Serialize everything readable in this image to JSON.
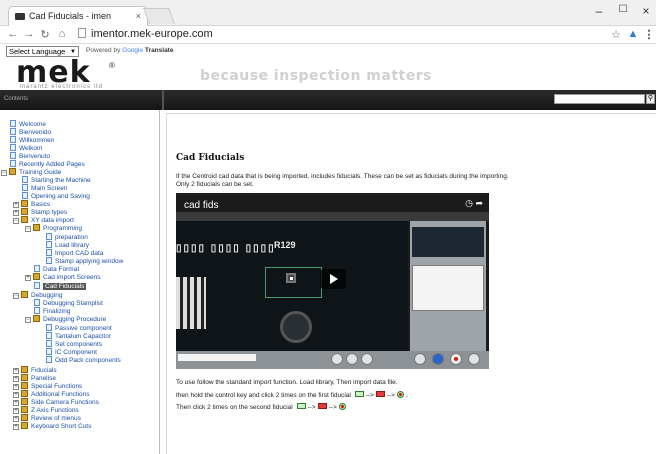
{
  "browser": {
    "tab_title": "Cad Fiducials - imen",
    "tab_close": "×",
    "url": "imentor.mek-europe.com",
    "win_minimize": "–",
    "win_maximize": "☐",
    "win_close": "×",
    "icons": [
      "back-icon",
      "forward-icon",
      "reload-icon",
      "home-icon",
      "page-icon",
      "star-icon",
      "extension-icon",
      "menu-icon"
    ]
  },
  "translate": {
    "select_label": "Select Language",
    "powered_by": "Powered by",
    "google": "Google",
    "translate_word": "Translate"
  },
  "header": {
    "logo": "mek",
    "logo_reg": "®",
    "logo_sub": "marantz electronics ltd",
    "slogan": "because inspection matters",
    "contents_label": "Contents"
  },
  "sidebar": {
    "items": [
      {
        "label": "Welcome",
        "icon": "page"
      },
      {
        "label": "Bienvenido",
        "icon": "page"
      },
      {
        "label": "Willkommen",
        "icon": "page"
      },
      {
        "label": "Welkom",
        "icon": "page"
      },
      {
        "label": "Benvenuto",
        "icon": "page"
      },
      {
        "label": "Recently Added Pages",
        "icon": "page"
      },
      {
        "label": "Training Guide",
        "icon": "book",
        "expander": "−"
      },
      {
        "label": "Starting the Machine",
        "icon": "page"
      },
      {
        "label": "Main Screen",
        "icon": "page"
      },
      {
        "label": "Opening and Saving",
        "icon": "page"
      },
      {
        "label": "Basics",
        "icon": "book",
        "expander": "+"
      },
      {
        "label": "Stamp types",
        "icon": "book",
        "expander": "+"
      },
      {
        "label": "XY data import",
        "icon": "book",
        "expander": "−"
      },
      {
        "label": "Programming",
        "icon": "book",
        "expander": "−"
      },
      {
        "label": "preparation",
        "icon": "page"
      },
      {
        "label": "Load library",
        "icon": "page"
      },
      {
        "label": "Import CAD data",
        "icon": "page"
      },
      {
        "label": "Stamp applying window",
        "icon": "page"
      },
      {
        "label": "Data Format",
        "icon": "page"
      },
      {
        "label": "Cad import Screens",
        "icon": "book",
        "expander": "+"
      },
      {
        "label": "Cad Fiducials",
        "icon": "page"
      },
      {
        "label": "Debugging",
        "icon": "book",
        "expander": "−"
      },
      {
        "label": "Debugging Stamplist",
        "icon": "page"
      },
      {
        "label": "Finalizing",
        "icon": "page"
      },
      {
        "label": "Debugging Procedure",
        "icon": "book",
        "expander": "−"
      },
      {
        "label": "Passive component",
        "icon": "page"
      },
      {
        "label": "Tantalum Capacitor",
        "icon": "page"
      },
      {
        "label": "Set components",
        "icon": "page"
      },
      {
        "label": "IC Component",
        "icon": "page"
      },
      {
        "label": "Odd Pack components",
        "icon": "page"
      },
      {
        "label": "Fiducials",
        "icon": "book",
        "expander": "+"
      },
      {
        "label": "Panelise",
        "icon": "book",
        "expander": "+"
      },
      {
        "label": "Special Functions",
        "icon": "book",
        "expander": "+"
      },
      {
        "label": "Additional Functions",
        "icon": "book",
        "expander": "+"
      },
      {
        "label": "Side Camera Functions",
        "icon": "book",
        "expander": "+"
      },
      {
        "label": "Z Axis Functions",
        "icon": "book",
        "expander": "+"
      },
      {
        "label": "Review of menus",
        "icon": "book",
        "expander": "+"
      },
      {
        "label": "Keyboard Short Cuts",
        "icon": "book",
        "expander": "+"
      }
    ]
  },
  "content": {
    "title": "Cad Fiducials",
    "intro_1": "If the Centroid cad data that is being imported, includes fiducials. These can be set as fiducials during the importing.",
    "intro_2": "Only 2 fiducials can be set.",
    "video": {
      "title": "cad fids",
      "label_r129": "R129",
      "label_codes": "▯▯▯▯ ▯▯▯▯ ▯▯▯▯"
    },
    "step_1": "To use follow the standard import function.  Load library,  Then import data file.",
    "step_2a": "then hold the control key and click 2 times on the first fiducial",
    "step_3a": "Then click 2 times on the second fiducial",
    "arrow": "-->",
    "period": "."
  }
}
